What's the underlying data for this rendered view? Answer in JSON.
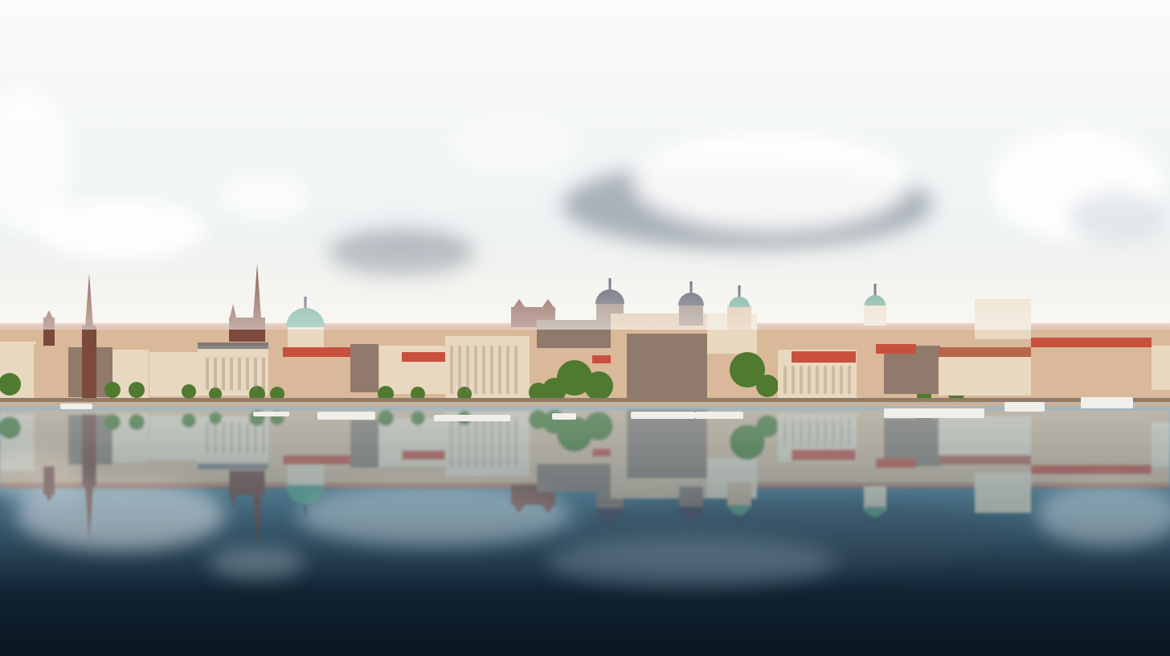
{
  "image": {
    "kind": "photo",
    "subject": "city-skyline-reflection"
  },
  "colors": {
    "sky_top": "#fbfbfa",
    "sky_mid": "#eef3f4",
    "sky_horizon": "#f4ead8",
    "cloud_light": "#ffffff",
    "cloud_dark": "#6f7a88",
    "water_top": "#9fb9c6",
    "water_mid": "#4c7489",
    "water_deep": "#102232",
    "water_bottom": "#0a1620",
    "building_cream": "#e8d8bf",
    "building_warm": "#d9b99a",
    "building_shadow": "#8f7a6c",
    "roof_red": "#c8513d",
    "roof_terracotta": "#b7654d",
    "dome_green": "#5fa38b",
    "dome_dark": "#4b4e5e",
    "spire_brown": "#7b4a3c",
    "tree_green": "#4f7a2f",
    "embankment": "#c9b39f",
    "boat_white": "#f1efea"
  }
}
